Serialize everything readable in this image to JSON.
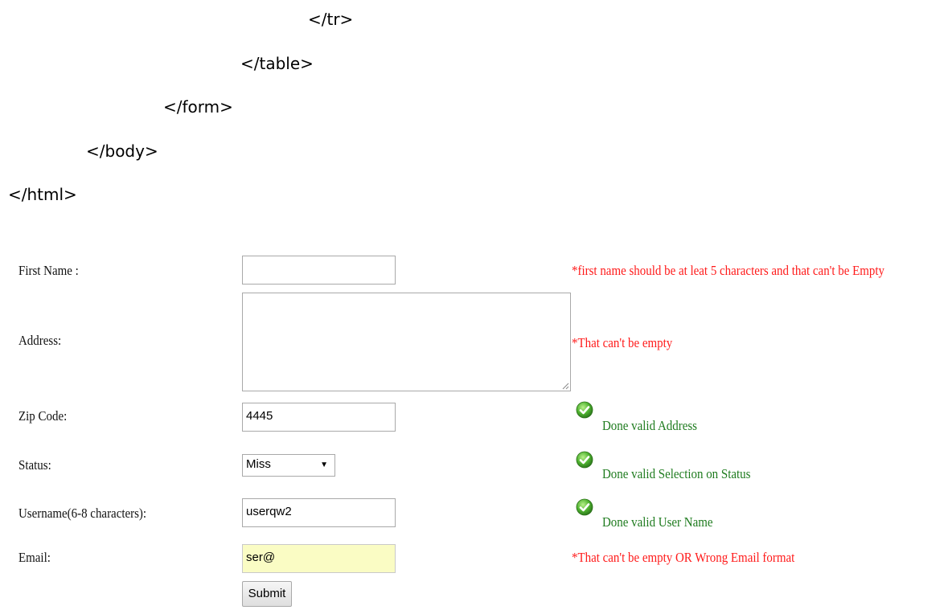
{
  "code": {
    "lines": [
      "</tr>",
      "</table>",
      "</form>",
      "</body>",
      "</html>"
    ]
  },
  "colors": {
    "error": "#ff1a1a",
    "success": "#1e7b1e",
    "focus_bg": "#fafcc4",
    "check_green": "#3aa32a"
  },
  "form": {
    "first_name": {
      "label": "First Name :",
      "value": "",
      "message": "*first name should be at leat 5 characters and that can't be Empty"
    },
    "address": {
      "label": "Address:",
      "value": "",
      "message": "*That can't be empty"
    },
    "zip": {
      "label": "Zip Code:",
      "value": "4445",
      "message": "Done valid Address",
      "message_icon": "check-circle-icon"
    },
    "status": {
      "label": "Status:",
      "selected": "Miss",
      "message": "Done valid Selection on Status",
      "message_icon": "check-circle-icon"
    },
    "username": {
      "label": "Username(6-8 characters):",
      "value": "userqw2",
      "message": "Done valid User Name",
      "message_icon": "check-circle-icon"
    },
    "email": {
      "label": "Email:",
      "value": "ser@",
      "message": "*That can't be empty OR Wrong Email format"
    },
    "submit_label": "Submit"
  }
}
